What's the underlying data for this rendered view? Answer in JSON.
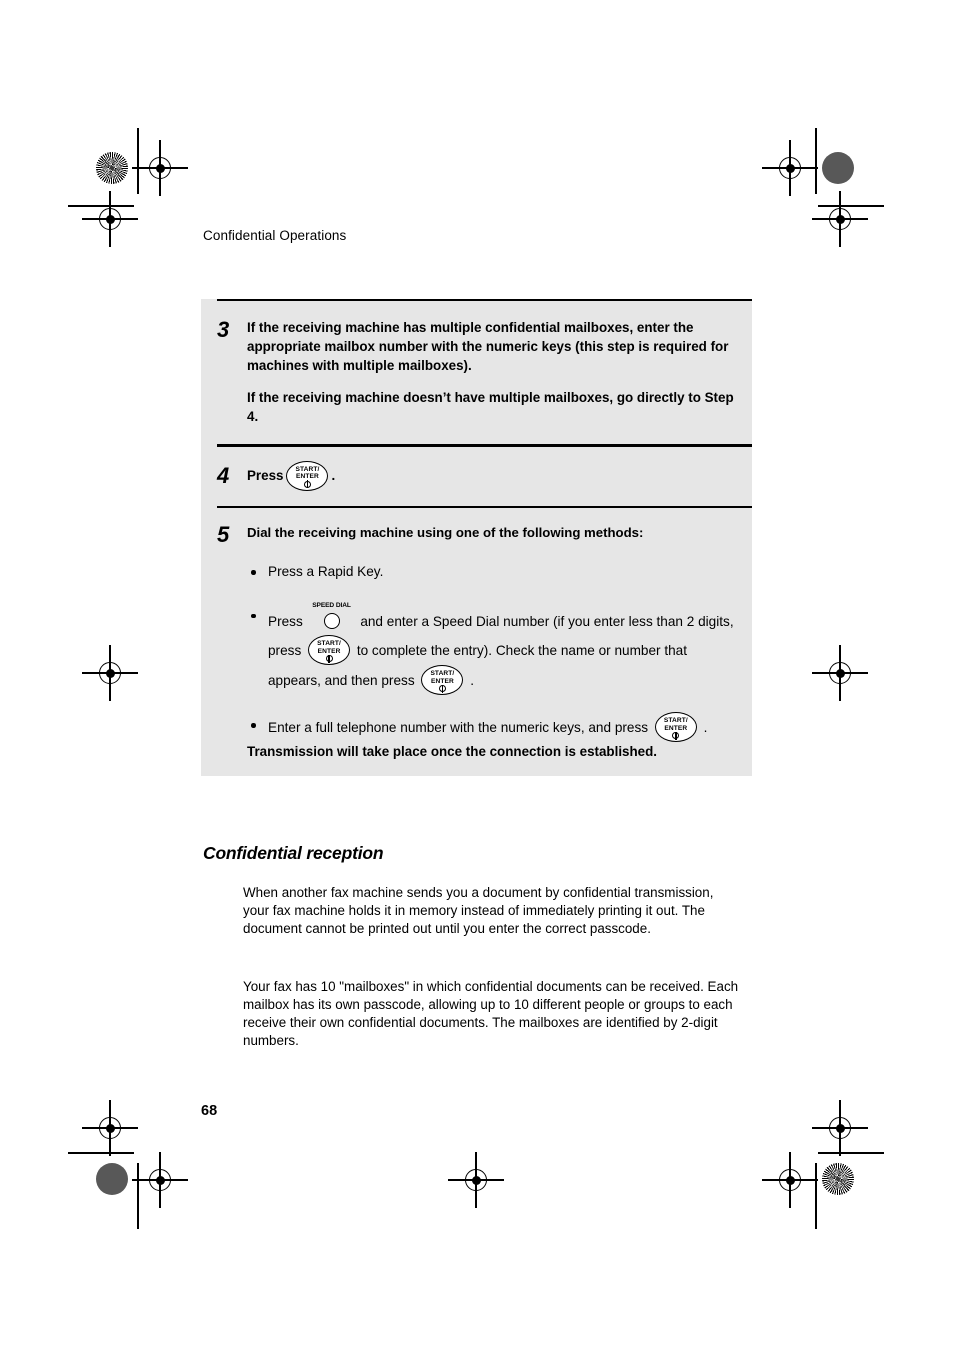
{
  "page": {
    "running_head": "Confidential Operations",
    "page_number": "68"
  },
  "keys": {
    "start_enter": {
      "line1": "START/",
      "line2": "ENTER",
      "icon": "start-enter-key-icon"
    },
    "speed_dial": {
      "label": "SPEED DIAL",
      "icon": "speed-dial-key-icon"
    }
  },
  "steps": [
    {
      "number": "3",
      "paragraphs": [
        "If the receiving machine has multiple confidential mailboxes, enter the appropriate mailbox number with the numeric keys (this step is required for machines with multiple mailboxes).",
        "If the receiving machine doesn’t have multiple mailboxes, go directly to Step 4."
      ]
    },
    {
      "number": "4",
      "press_label": "Press",
      "press_suffix": "."
    },
    {
      "number": "5",
      "heading": "Dial the receiving machine using one of the following methods:",
      "methods": [
        {
          "text": "Press a Rapid Key."
        },
        {
          "seg1": "Press",
          "seg2": "and enter a Speed Dial number (if you enter less than 2 digits, press",
          "seg3": "to complete the entry). Check the name or number that appears, and then press",
          "seg4": "."
        },
        {
          "seg1": "Enter a full telephone number with the numeric keys, and press",
          "seg2": "."
        }
      ],
      "closing": "Transmission will take place once the connection is established."
    }
  ],
  "section": {
    "heading": "Confidential reception",
    "paragraphs": [
      "When another fax machine sends you a document by confidential transmission, your fax machine holds it in memory instead of immediately printing it out. The document cannot be printed out until you enter the correct passcode.",
      "Your fax has 10 \"mailboxes\" in which confidential documents can be received. Each mailbox has its own passcode, allowing up to 10 different people or groups to each receive their own confidential documents. The mailboxes are identified by 2-digit numbers."
    ]
  },
  "colors": {
    "panel_background": "#e6e6e6",
    "rule": "#000000",
    "text": "#000000"
  }
}
